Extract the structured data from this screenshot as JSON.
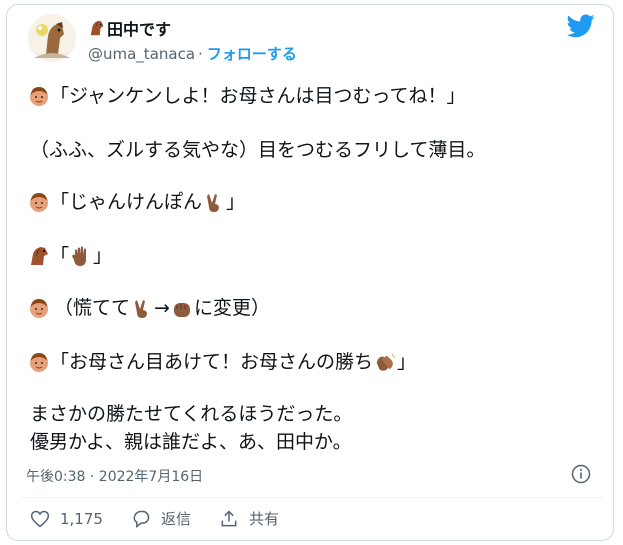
{
  "author": {
    "display_name": "田中です",
    "handle": "@uma_tanaca",
    "separator": "·",
    "follow_label": "フォローする"
  },
  "tweet": {
    "line1": "「ジャンケンしよ！お母さんは目つむってね！」",
    "line2": "（ふふ、ズルする気やな）目をつむるフリして薄目。",
    "line3_open": "「じゃんけんぽん",
    "line3_close": "」",
    "line4_open": "「",
    "line4_close": "」",
    "line5_open": "（慌てて",
    "line5_arrow": "→",
    "line5_close": "に変更）",
    "line6_open": "「お母さん目あけて！お母さんの勝ち",
    "line6_close": "」",
    "line7": "まさかの勝たせてくれるほうだった。",
    "line8": "優男かよ、親は誰だよ、あ、田中か。"
  },
  "timestamp": "午後0:38 · 2022年7月16日",
  "actions": {
    "like_count": "1,175",
    "reply_label": "返信",
    "share_label": "共有"
  },
  "colors": {
    "accent": "#1d9bf0",
    "text": "#0f1419",
    "muted": "#536471",
    "skin_face": "#e8a07a",
    "skin_hand": "#8d5b3c"
  },
  "icons": [
    "avatar-image",
    "horse-emoji",
    "twitter-bird-icon",
    "boy-face-emoji",
    "victory-hand-emoji",
    "raised-hand-emoji",
    "fist-emoji",
    "clapping-hands-emoji",
    "info-icon",
    "heart-icon",
    "reply-icon",
    "share-icon"
  ]
}
